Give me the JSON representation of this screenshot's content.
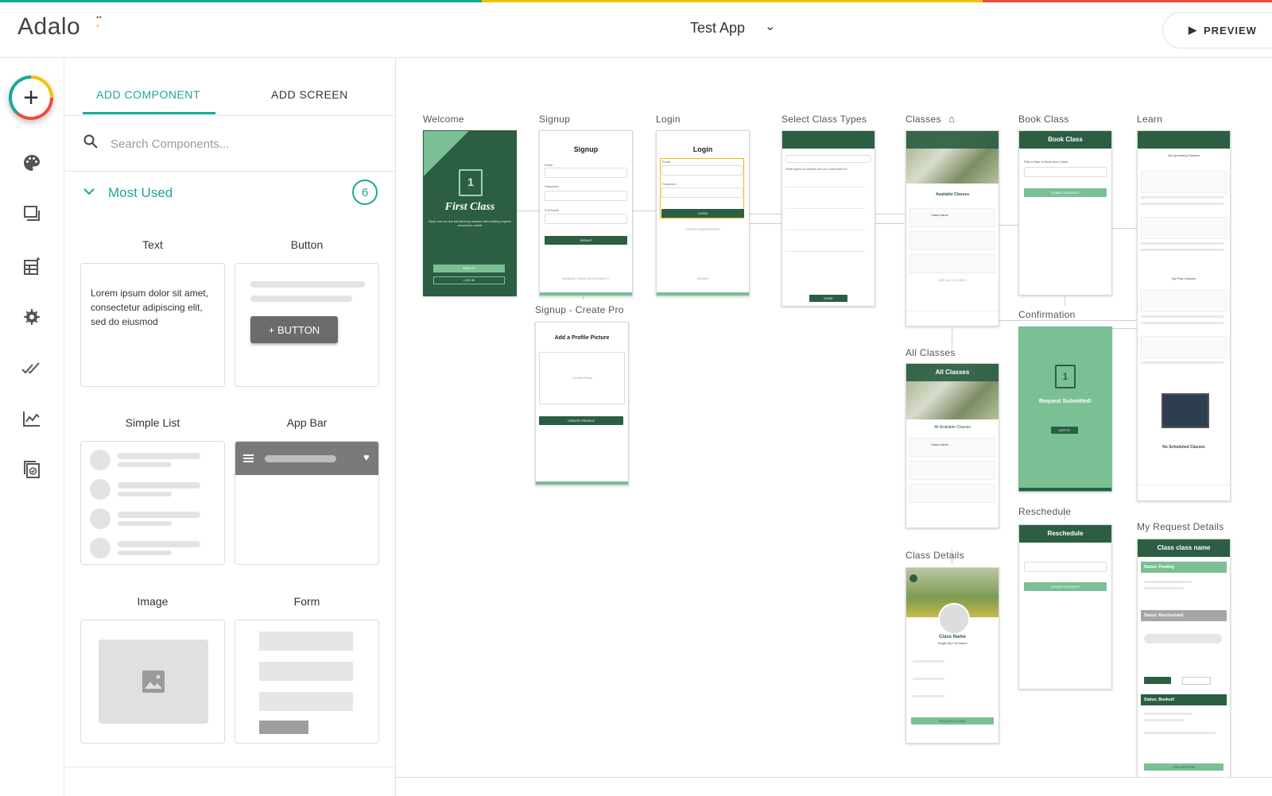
{
  "header": {
    "logo_text": "Adalo",
    "app_name": "Test App",
    "preview_label": "PREVIEW",
    "stripe_colors": [
      "#1aa79a",
      "#f2c200",
      "#ef4b3e"
    ]
  },
  "leftbar": {
    "icons": [
      "add-icon",
      "palette-icon",
      "screens-icon",
      "database-icon",
      "gear-icon",
      "publish-check-icon",
      "analytics-icon",
      "checklist-icon"
    ]
  },
  "panel": {
    "tabs": [
      {
        "label": "ADD COMPONENT",
        "active": true
      },
      {
        "label": "ADD SCREEN",
        "active": false
      }
    ],
    "search": {
      "placeholder": "Search Components..."
    },
    "section": {
      "label": "Most Used",
      "count": "6"
    },
    "components": [
      {
        "label": "Text",
        "sample": "Lorem ipsum dolor sit amet, consectetur adipiscing elit, sed do eiusmod"
      },
      {
        "label": "Button",
        "sample": "+ BUTTON"
      },
      {
        "label": "Simple List"
      },
      {
        "label": "App Bar"
      },
      {
        "label": "Image"
      },
      {
        "label": "Form"
      }
    ],
    "accent_color": "#1aa79a"
  },
  "canvas": {
    "screens": [
      {
        "label": "Welcome",
        "brand": "First Class",
        "tagline": "Book one-on-one introductory classes with leading experts around the world!",
        "buttons": [
          "SIGN UP",
          "LOG IN"
        ]
      },
      {
        "label": "Signup",
        "title": "Signup",
        "fields": [
          "Email",
          "Password",
          "Full Name"
        ],
        "button": "SIGNUP",
        "footer": "ALREADY HAVE AN ACCOUNT?"
      },
      {
        "label": "Login",
        "title": "Login",
        "fields": [
          "Email",
          "Password"
        ],
        "button": "LOGIN",
        "link": "FORGOT PASSWORD?",
        "footer": "SIGNUP"
      },
      {
        "label": "Select Class Types",
        "question": "What types of classes are you interested in?",
        "button": "DONE"
      },
      {
        "label": "Classes",
        "heading": "Available Classes",
        "row": "Class Name",
        "link": "SEE ALL CLASSES"
      },
      {
        "label": "Book Class",
        "title": "Book Class",
        "prompt": "Pick a Date to Book your Class",
        "button": "SUBMIT REQUEST"
      },
      {
        "label": "Learn",
        "section1": "My Upcoming Classes",
        "section2": "My Past Classes",
        "empty": "No Scheduled Classes"
      },
      {
        "label": "Signup - Create Pro",
        "title": "Add a Profile Picture",
        "photo": "Choose Photo",
        "button": "CREATE PROFILE"
      },
      {
        "label": "Confirmation",
        "title": "Request Submitted!",
        "button": "GOT IT!"
      },
      {
        "label": "All Classes",
        "title": "All Classes",
        "heading": "All Available Classes",
        "row": "Class Name"
      },
      {
        "label": "Reschedule",
        "title": "Reschedule",
        "button": "UPDATE REQUEST"
      },
      {
        "label": "My Request Details",
        "title": "Class class name",
        "status1": "Status: Pending",
        "status2": "Status: Rescheduled",
        "status3": "Status: Booked!",
        "button": "JOIN MEETING"
      },
      {
        "label": "Class Details",
        "name": "Class Name",
        "teacher": "Taught By Full Name",
        "button": "REQUEST CLASS"
      }
    ],
    "primary_color": "#2c5e44",
    "secondary_color": "#7bbf95"
  }
}
